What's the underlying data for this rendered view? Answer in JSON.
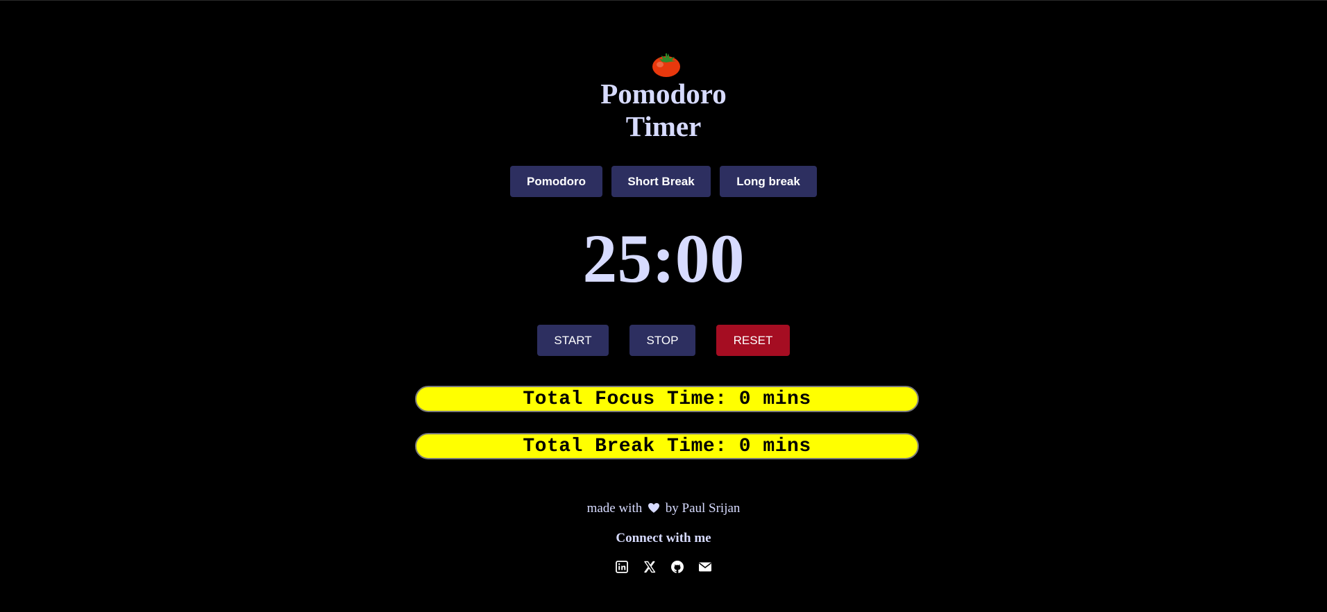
{
  "app": {
    "logo_icon": "tomato-icon",
    "title_line1": "Pomodoro",
    "title_line2": "Timer"
  },
  "modes": [
    {
      "label": "Pomodoro"
    },
    {
      "label": "Short Break"
    },
    {
      "label": "Long break"
    }
  ],
  "timer": {
    "display": "25:00"
  },
  "controls": {
    "start_label": "START",
    "stop_label": "STOP",
    "reset_label": "RESET"
  },
  "stats": {
    "focus_text": "Total Focus Time: 0 mins",
    "break_text": "Total Break Time: 0 mins"
  },
  "footer": {
    "made_with": "made with",
    "by_text": "by Paul Srijan",
    "connect": "Connect with me",
    "socials": [
      {
        "icon": "linkedin-icon"
      },
      {
        "icon": "x-twitter-icon"
      },
      {
        "icon": "github-icon"
      },
      {
        "icon": "email-icon"
      }
    ]
  },
  "colors": {
    "background": "#000000",
    "text": "#d7dbff",
    "button": "#2d2f60",
    "reset": "#a50d22",
    "stat_bg": "#ffff00"
  }
}
